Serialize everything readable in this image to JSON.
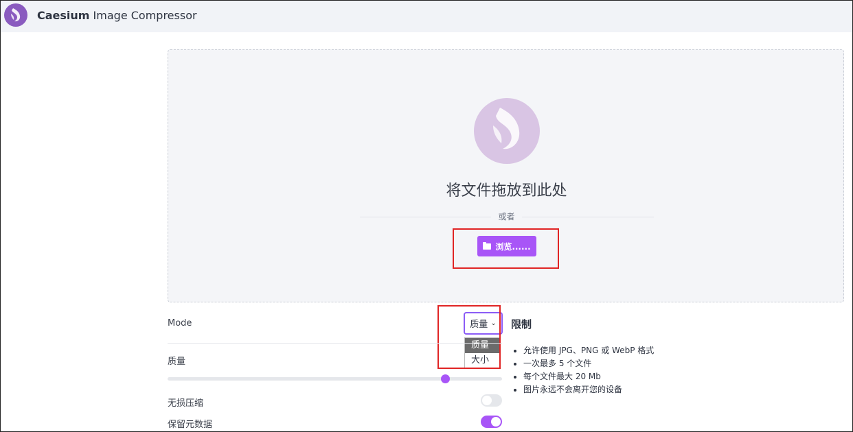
{
  "header": {
    "app_name_bold": "Caesium",
    "app_name_rest": " Image Compressor"
  },
  "dropzone": {
    "drop_text": "将文件拖放到此处",
    "or_text": "或者",
    "browse_label": "浏览......"
  },
  "settings": {
    "mode_label": "Mode",
    "mode_selected": "质量",
    "mode_options": [
      "质量",
      "大小"
    ],
    "quality_label": "质量",
    "quality_value_percent": 83,
    "lossless_label": "无损压缩",
    "lossless_on": false,
    "keep_metadata_label": "保留元数据",
    "keep_metadata_on": true
  },
  "limits": {
    "title": "限制",
    "items": [
      "允许使用 JPG、PNG 或 WebP 格式",
      "一次最多 5 个文件",
      "每个文件最大 20 Mb",
      "图片永远不会离开您的设备"
    ]
  },
  "colors": {
    "accent": "#a855f7",
    "annotation_red": "#e02424"
  }
}
